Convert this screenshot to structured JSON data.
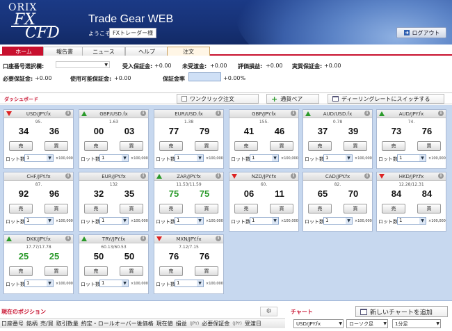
{
  "header": {
    "brand_orix": "ORIX",
    "brand_fx": "FX",
    "brand_cfd": "CFD",
    "app_title": "Trade Gear WEB",
    "welcome": "ようこそ",
    "user_name": "FXトレーダー様",
    "logout_label": "ログアウト"
  },
  "tabs": [
    "ホーム",
    "報告書",
    "ニュース",
    "ヘルプ",
    "注文"
  ],
  "account": {
    "selector_label": "口座番号選択欄:",
    "deposit_margin_label": "受入保証金:",
    "deposit_margin_value": "+0.00",
    "unsettled_label": "未受渡金:",
    "unsettled_value": "+0.00",
    "valuation_label": "評価損益:",
    "valuation_value": "+0.00",
    "actual_margin_label": "実質保証金:",
    "actual_margin_value": "+0.00",
    "required_margin_label": "必要保証金:",
    "required_margin_value": "+0.00",
    "available_margin_label": "使用可能保証金:",
    "available_margin_value": "+0.00",
    "margin_rate_label": "保証金率",
    "margin_rate_value": "+0.00%",
    "margin_rate_fraction": 0
  },
  "dashboard": {
    "title": "ダッシュボード",
    "one_click_label": "ワンクリック注文",
    "add_pair_label": "通貨ペア",
    "switch_label": "ディーリングレートにスイッチする"
  },
  "tiles": [
    {
      "pair": "USD/JPY.fx",
      "dir": "down",
      "spread": "95.",
      "bid": "34",
      "ask": "36",
      "green": false
    },
    {
      "pair": "GBP/USD.fx",
      "dir": "up",
      "spread": "1.63",
      "bid": "00",
      "ask": "03",
      "green": false
    },
    {
      "pair": "EUR/USD.fx",
      "dir": "none",
      "spread": "1.38",
      "bid": "77",
      "ask": "79",
      "green": false
    },
    {
      "pair": "GBP/JPY.fx",
      "dir": "none",
      "spread": "155.",
      "bid": "41",
      "ask": "46",
      "green": false
    },
    {
      "pair": "AUD/USD.fx",
      "dir": "up",
      "spread": "0.78",
      "bid": "37",
      "ask": "39",
      "green": false
    },
    {
      "pair": "AUD/JPY.fx",
      "dir": "up",
      "spread": "74.",
      "bid": "73",
      "ask": "76",
      "green": false
    },
    {
      "pair": "CHF/JPY.fx",
      "dir": "none",
      "spread": "87.",
      "bid": "92",
      "ask": "96",
      "green": false
    },
    {
      "pair": "EUR/JPY.fx",
      "dir": "none",
      "spread": "132",
      "bid": "32",
      "ask": "35",
      "green": false
    },
    {
      "pair": "ZAR/JPY.fx",
      "dir": "up",
      "spread": "11.53/11.59",
      "bid": "75",
      "ask": "75",
      "green": true
    },
    {
      "pair": "NZD/JPY.fx",
      "dir": "down",
      "spread": "60.",
      "bid": "06",
      "ask": "11",
      "green": false
    },
    {
      "pair": "CAD/JPY.fx",
      "dir": "none",
      "spread": "82.",
      "bid": "65",
      "ask": "70",
      "green": false
    },
    {
      "pair": "HKD/JPY.fx",
      "dir": "down",
      "spread": "12.28/12.31",
      "bid": "84",
      "ask": "84",
      "green": false
    },
    {
      "pair": "DKK/JPY.fx",
      "dir": "up",
      "spread": "17.77/17.78",
      "bid": "25",
      "ask": "25",
      "green": true
    },
    {
      "pair": "TRY/JPY.fx",
      "dir": "up",
      "spread": "60.13/60.53",
      "bid": "50",
      "ask": "50",
      "green": false
    },
    {
      "pair": "MXN/JPY.fx",
      "dir": "down",
      "spread": "7.12/7.15",
      "bid": "76",
      "ask": "76",
      "green": false
    }
  ],
  "tile_common": {
    "sell_label": "売",
    "buy_label": "買",
    "lot_label": "ロット数:",
    "lot_value": "1",
    "unit_label": "×100,000"
  },
  "positions": {
    "title": "現在のポジション",
    "columns": [
      {
        "text": "口座番号",
        "small": false
      },
      {
        "text": "銘柄",
        "small": false
      },
      {
        "text": "売/買",
        "small": false
      },
      {
        "text": "取引数量",
        "small": false
      },
      {
        "text": "約定・ロールオーバー後価格",
        "small": false
      },
      {
        "text": "現在値",
        "small": false
      },
      {
        "text": "損益",
        "small": false
      },
      {
        "text": "(JPY)",
        "small": true
      },
      {
        "text": "必要保証金",
        "small": false
      },
      {
        "text": "(JPY)",
        "small": true
      },
      {
        "text": "受渡日",
        "small": false
      }
    ]
  },
  "chart_panel": {
    "title": "チャート",
    "new_chart_label": "新しいチャートを追加",
    "pair_select": "USD/JPY.fx",
    "type_select": "ローソク足",
    "interval_select": "1分足"
  }
}
